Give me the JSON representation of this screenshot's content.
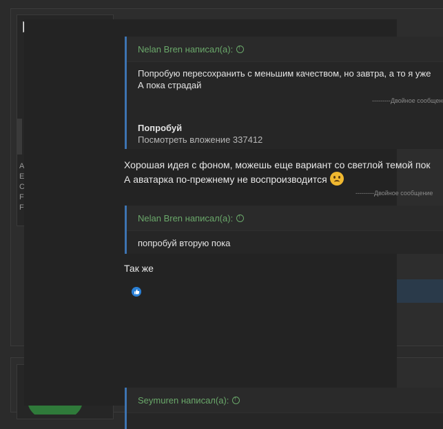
{
  "quote1": {
    "header": "Nelan Bren написал(а):",
    "line1": "Попробую пересохранить с меньшим качеством, но завтра, а то я уже",
    "line2": "А пока страдай",
    "divider": "---------Двойное сообщение",
    "bold_text": "Попробуй",
    "attachment": "Посмотреть вложение 337412"
  },
  "message": {
    "line1": "Хорошая идея с фоном, можешь еще вариант со светлой темой пок",
    "line2": "А аватарка по-прежнему не воспроизводится",
    "divider": "---------Двойное сообщение"
  },
  "quote2": {
    "header": "Nelan Bren написал(а):",
    "body": "попробуй вторую пока"
  },
  "reply": "Так же",
  "quote3": {
    "header": "Seymuren написал(а):"
  },
  "side_letters": [
    "A",
    "E",
    "C",
    "F",
    "F"
  ],
  "colors": {
    "quote_border": "#3d74b2",
    "quote_author": "#6aa86a",
    "like": "#2a7fd4"
  },
  "icons": {
    "goto_quote": "arrow-up-circle-icon",
    "reaction": "thumbs-up-icon",
    "avatar_broken": "broken-image-icon",
    "emoji": "frowning-face-icon"
  }
}
